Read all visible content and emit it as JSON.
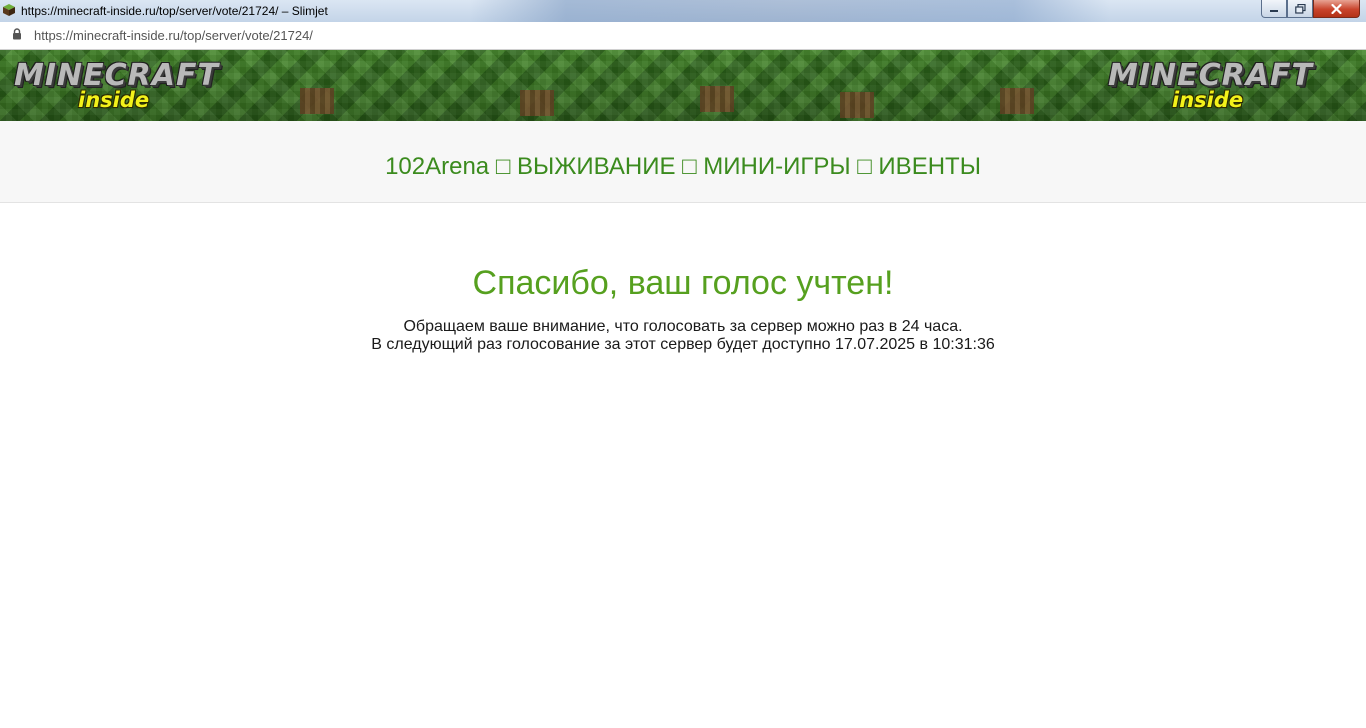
{
  "window": {
    "title": "https://minecraft-inside.ru/top/server/vote/21724/ – Slimjet",
    "icon": "slimjet-cube-icon"
  },
  "address_bar": {
    "url": "https://minecraft-inside.ru/top/server/vote/21724/",
    "icon": "lock-icon"
  },
  "banner": {
    "logo_text": "MINECRAFT",
    "logo_subtext": "inside",
    "colors": {
      "grass": "#3f8a26",
      "logo_sub": "#f3f21a"
    }
  },
  "server": {
    "name": "102Arena □ ВЫЖИВАНИЕ □ МИНИ-ИГРЫ □ ИВЕНТЫ",
    "color": "#3b8b1e"
  },
  "vote_result": {
    "heading": "Спасибо, ваш голос учтен!",
    "notice_line1": "Обращаем ваше внимание, что голосовать за сервер можно раз в 24 часа.",
    "notice_line2": "В следующий раз голосование за этот сервер будет доступно 17.07.2025 в 10:31:36",
    "heading_color": "#56a01f"
  }
}
